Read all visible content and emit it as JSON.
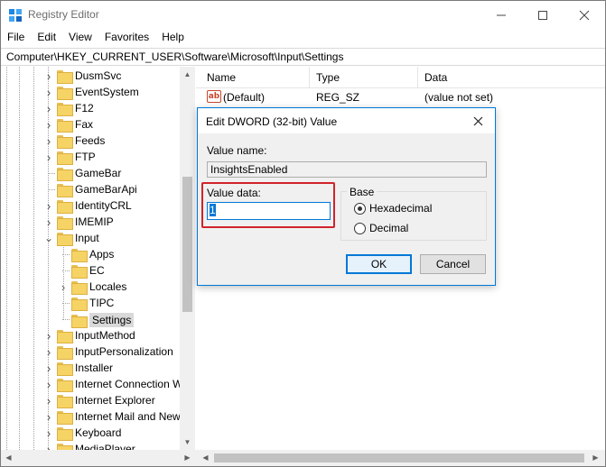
{
  "window": {
    "title": "Registry Editor",
    "accent": "#0078d7"
  },
  "menu": [
    "File",
    "Edit",
    "View",
    "Favorites",
    "Help"
  ],
  "address": "Computer\\HKEY_CURRENT_USER\\Software\\Microsoft\\Input\\Settings",
  "tree": {
    "items": [
      {
        "label": "DusmSvc",
        "expandable": true,
        "expanded": false,
        "level": 0
      },
      {
        "label": "EventSystem",
        "expandable": true,
        "expanded": false,
        "level": 0
      },
      {
        "label": "F12",
        "expandable": true,
        "expanded": false,
        "level": 0
      },
      {
        "label": "Fax",
        "expandable": true,
        "expanded": false,
        "level": 0
      },
      {
        "label": "Feeds",
        "expandable": true,
        "expanded": false,
        "level": 0
      },
      {
        "label": "FTP",
        "expandable": true,
        "expanded": false,
        "level": 0
      },
      {
        "label": "GameBar",
        "expandable": false,
        "expanded": false,
        "level": 0
      },
      {
        "label": "GameBarApi",
        "expandable": false,
        "expanded": false,
        "level": 0
      },
      {
        "label": "IdentityCRL",
        "expandable": true,
        "expanded": false,
        "level": 0
      },
      {
        "label": "IMEMIP",
        "expandable": true,
        "expanded": false,
        "level": 0
      },
      {
        "label": "Input",
        "expandable": true,
        "expanded": true,
        "level": 0
      },
      {
        "label": "Apps",
        "expandable": false,
        "expanded": false,
        "level": 1
      },
      {
        "label": "EC",
        "expandable": false,
        "expanded": false,
        "level": 1
      },
      {
        "label": "Locales",
        "expandable": true,
        "expanded": false,
        "level": 1
      },
      {
        "label": "TIPC",
        "expandable": false,
        "expanded": false,
        "level": 1
      },
      {
        "label": "Settings",
        "expandable": false,
        "expanded": false,
        "level": 1,
        "selected": true
      },
      {
        "label": "InputMethod",
        "expandable": true,
        "expanded": false,
        "level": 0
      },
      {
        "label": "InputPersonalization",
        "expandable": true,
        "expanded": false,
        "level": 0
      },
      {
        "label": "Installer",
        "expandable": true,
        "expanded": false,
        "level": 0
      },
      {
        "label": "Internet Connection W",
        "expandable": true,
        "expanded": false,
        "level": 0
      },
      {
        "label": "Internet Explorer",
        "expandable": true,
        "expanded": false,
        "level": 0
      },
      {
        "label": "Internet Mail and New",
        "expandable": true,
        "expanded": false,
        "level": 0
      },
      {
        "label": "Keyboard",
        "expandable": true,
        "expanded": false,
        "level": 0
      },
      {
        "label": "MediaPlayer",
        "expandable": true,
        "expanded": false,
        "level": 0
      }
    ]
  },
  "list": {
    "columns": [
      "Name",
      "Type",
      "Data"
    ],
    "rows": [
      {
        "icon": "ab",
        "name": "(Default)",
        "type": "REG_SZ",
        "data": "(value not set)"
      }
    ]
  },
  "dialog": {
    "title": "Edit DWORD (32-bit) Value",
    "value_name_label": "Value name:",
    "value_name": "InsightsEnabled",
    "value_data_label": "Value data:",
    "value_data": "1",
    "base_label": "Base",
    "base_options": [
      {
        "label": "Hexadecimal",
        "checked": true
      },
      {
        "label": "Decimal",
        "checked": false
      }
    ],
    "ok_label": "OK",
    "cancel_label": "Cancel",
    "highlight_color": "#d1232a"
  }
}
